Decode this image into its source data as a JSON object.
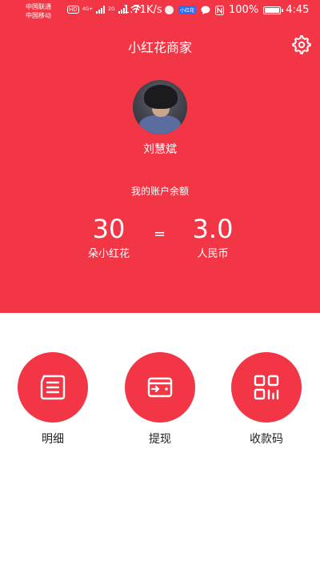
{
  "status_bar": {
    "carrier_1": "中国联通",
    "carrier_2": "中国移动",
    "hd_badge": "HD",
    "net_1": "4G+",
    "net_2": "2G",
    "speed": "1.71K/s",
    "app_badge": "小红花",
    "battery_pct": "100%",
    "battery_level": 1.0,
    "time": "4:45"
  },
  "header": {
    "title": "小红花商家",
    "background_color": "#F23646"
  },
  "profile": {
    "name": "刘慧斌"
  },
  "balance": {
    "label": "我的账户余额",
    "flowers_value": "30",
    "flowers_unit": "朵小红花",
    "equals": "=",
    "rmb_value": "3.0",
    "rmb_unit": "人民币"
  },
  "actions": [
    {
      "label": "明细",
      "icon": "list-document-icon"
    },
    {
      "label": "提现",
      "icon": "wallet-icon"
    },
    {
      "label": "收款码",
      "icon": "qr-code-icon"
    }
  ]
}
